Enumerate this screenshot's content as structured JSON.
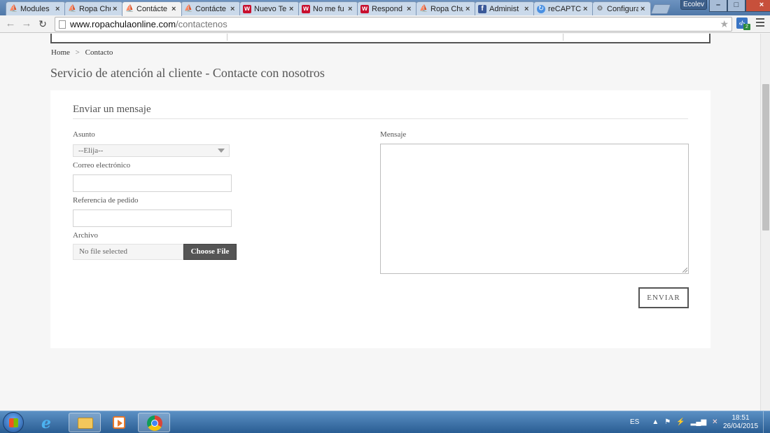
{
  "browser": {
    "tabs": [
      {
        "label": "Modules",
        "favicon": "prestashop-icon",
        "active": false
      },
      {
        "label": "Ropa Chu",
        "favicon": "prestashop-icon",
        "active": false
      },
      {
        "label": "Contácte",
        "favicon": "prestashop-icon",
        "active": true
      },
      {
        "label": "Contácte",
        "favicon": "prestashop-icon",
        "active": false
      },
      {
        "label": "Nuevo Te",
        "favicon": "wallapop-icon",
        "active": false
      },
      {
        "label": "No me fu",
        "favicon": "wallapop-icon",
        "active": false
      },
      {
        "label": "Respond",
        "favicon": "wallapop-icon",
        "active": false
      },
      {
        "label": "Ropa Chu",
        "favicon": "prestashop-icon",
        "active": false
      },
      {
        "label": "Administ",
        "favicon": "facebook-icon",
        "active": false
      },
      {
        "label": "reCAPTCH",
        "favicon": "recaptcha-icon",
        "active": false
      },
      {
        "label": "Configura",
        "favicon": "gear-icon",
        "active": false
      }
    ],
    "close_glyph": "×",
    "user_label": "Ecolev",
    "window_buttons": {
      "minimize": "–",
      "maximize": "□",
      "close": "×"
    },
    "url_host": "www.ropachulaonline.com",
    "url_path": "/contactenos",
    "extension_badge": "2"
  },
  "page": {
    "breadcrumb": {
      "home": "Home",
      "separator": ">",
      "current": "Contacto"
    },
    "title": "Servicio de atención al cliente - Contacte con nosotros",
    "form": {
      "heading": "Enviar un mensaje",
      "subject_label": "Asunto",
      "subject_value": "--Elija--",
      "email_label": "Correo electrónico",
      "email_value": "",
      "order_ref_label": "Referencia de pedido",
      "order_ref_value": "",
      "file_label": "Archivo",
      "file_status": "No file selected",
      "file_button": "Choose File",
      "message_label": "Mensaje",
      "message_value": "",
      "submit_label": "ENVIAR"
    }
  },
  "taskbar": {
    "language": "ES",
    "time": "18:51",
    "date": "26/04/2015"
  },
  "colors": {
    "tab_strip": "#5e87b5",
    "page_background": "#f6f6f6",
    "card_background": "#ffffff",
    "file_button": "#555555",
    "taskbar": "#2a5d93"
  }
}
